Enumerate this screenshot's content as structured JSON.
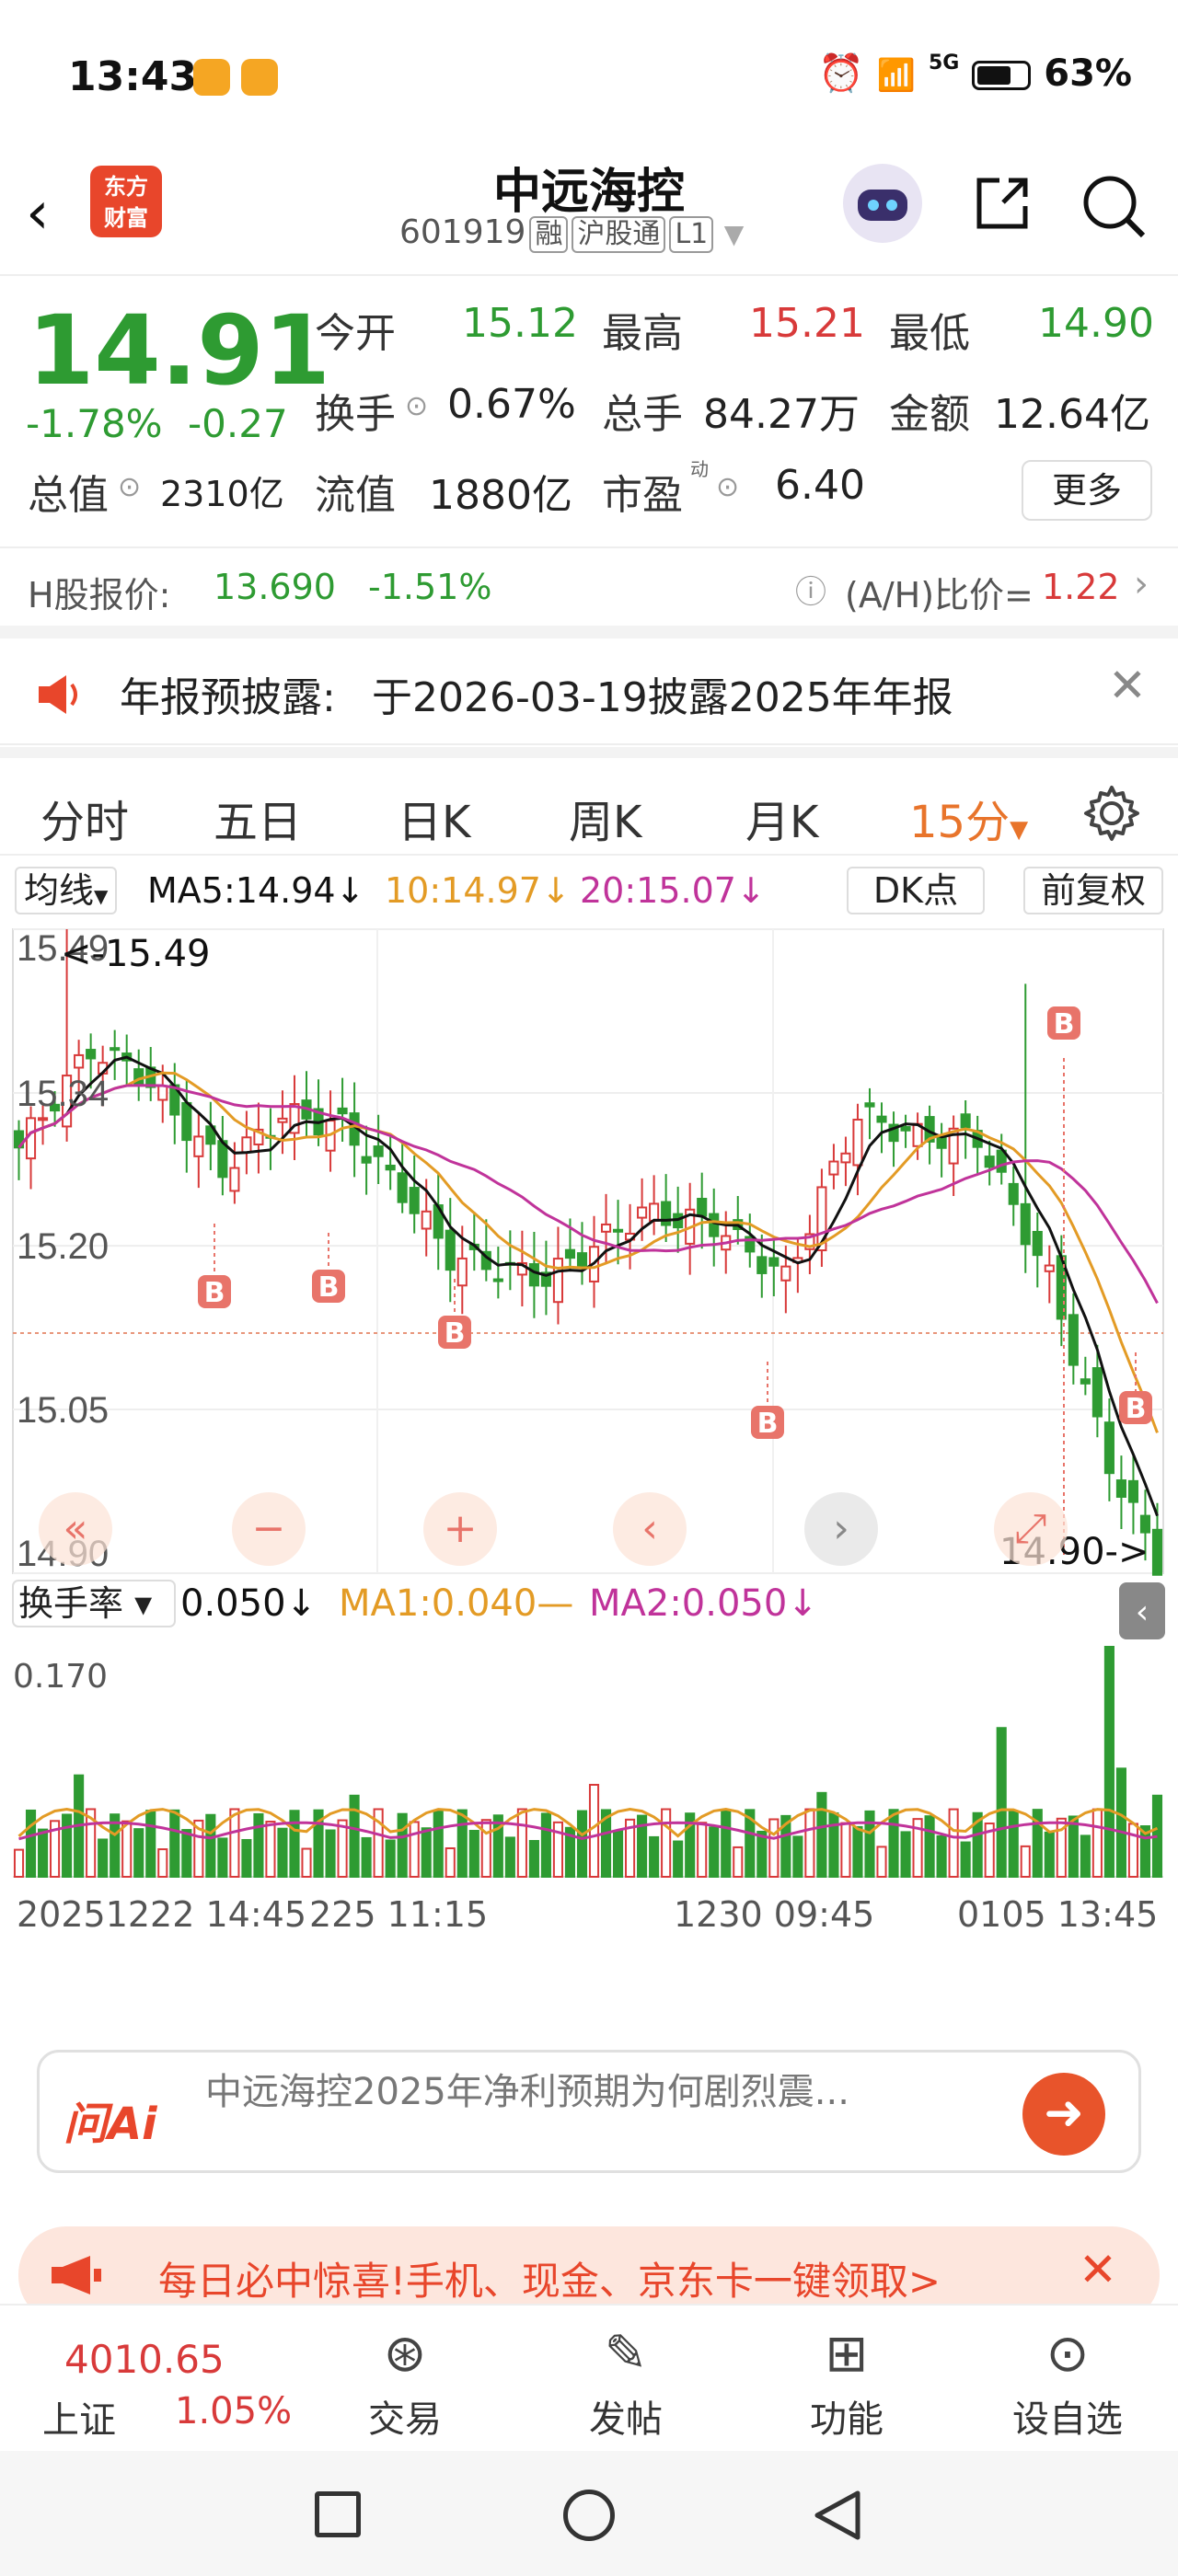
{
  "status": {
    "time": "13:43",
    "battery": "63%",
    "network": "5G"
  },
  "header": {
    "logo_text_1": "东方",
    "logo_text_2": "财富",
    "name": "中远海控",
    "code": "601919",
    "tags": [
      "融",
      "沪股通",
      "L1"
    ]
  },
  "quote": {
    "price": "14.91",
    "pct": "-1.78%",
    "chg": "-0.27",
    "open_label": "今开",
    "open": "15.12",
    "high_label": "最高",
    "high": "15.21",
    "low_label": "最低",
    "low": "14.90",
    "turnover_label": "换手",
    "turnover": "0.67%",
    "volume_label": "总手",
    "volume": "84.27万",
    "amount_label": "金额",
    "amount": "12.64亿",
    "mktcap_label": "总值",
    "mktcap": "2310亿",
    "float_label": "流值",
    "float": "1880亿",
    "pe_label": "市盈",
    "pe_sup": "动",
    "pe": "6.40",
    "more": "更多"
  },
  "hshare": {
    "label": "H股报价:",
    "price": "13.690",
    "pct": "-1.51%",
    "ratio_label": "(A/H)比价=",
    "ratio": "1.22"
  },
  "notice": {
    "title": "年报预披露:",
    "text": "于2026-03-19披露2025年年报"
  },
  "tabs": [
    "分时",
    "五日",
    "日K",
    "周K",
    "月K",
    "15分"
  ],
  "ma": {
    "type": "均线",
    "ma5": "MA5:14.94",
    "ma10": "10:14.97",
    "ma20": "20:15.07",
    "dk": "DK点",
    "fq": "前复权"
  },
  "chart_data": {
    "type": "candlestick",
    "price_axis": {
      "labels": [
        "15.49",
        "15.34",
        "15.20",
        "15.05",
        "14.90"
      ],
      "ylim": [
        14.9,
        15.49
      ]
    },
    "annotations": {
      "max": "<-15.49",
      "min": "14.90->",
      "buy_marker": "B"
    },
    "x_labels": [
      "20251222 14:45",
      "225 11:15",
      "1230 09:45",
      "0105 13:45"
    ],
    "volume": {
      "indicator": "换手率",
      "value": "0.050",
      "ma1": "MA1:0.040",
      "ma2": "MA2:0.050",
      "axis_max": "0.170"
    },
    "colors": {
      "up": "#d83a3a",
      "down": "#2e9b32",
      "ma5": "#111111",
      "ma10": "#e39b25",
      "ma20": "#c0339a"
    }
  },
  "ai": {
    "logo": "问Ai",
    "question": "中远海控2025年净利预期为何剧烈震..."
  },
  "promo": {
    "text": "每日必中惊喜!手机、现金、京东卡一键领取>"
  },
  "bottom": {
    "index_value": "4010.65",
    "index_name": "上证",
    "index_pct": "1.05%",
    "items": [
      "交易",
      "发帖",
      "功能",
      "设自选"
    ]
  }
}
